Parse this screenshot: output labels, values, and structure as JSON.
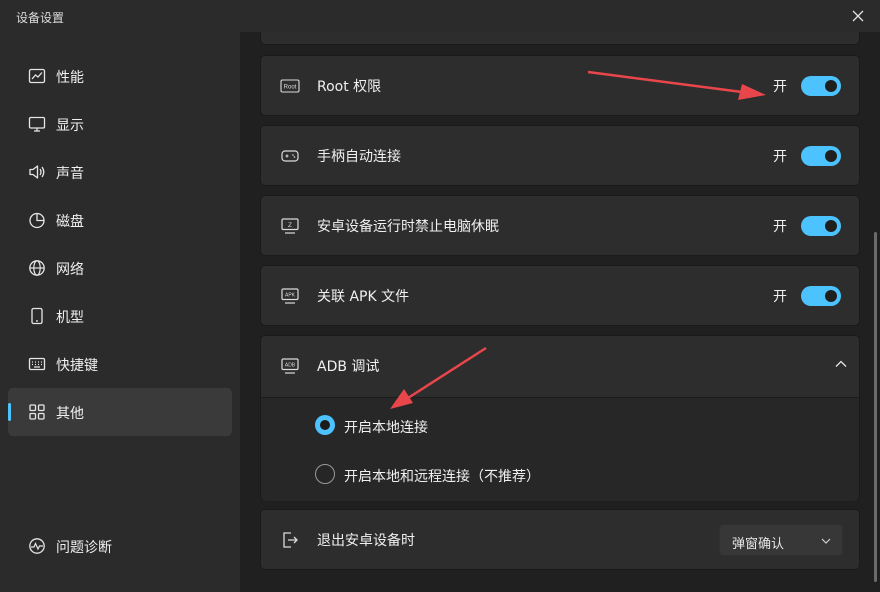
{
  "window": {
    "title": "设备设置"
  },
  "sidebar": {
    "items": [
      {
        "label": "性能",
        "icon": "performance-chart-icon"
      },
      {
        "label": "显示",
        "icon": "monitor-icon"
      },
      {
        "label": "声音",
        "icon": "speaker-icon"
      },
      {
        "label": "磁盘",
        "icon": "disk-pie-icon"
      },
      {
        "label": "网络",
        "icon": "globe-icon"
      },
      {
        "label": "机型",
        "icon": "phone-icon"
      },
      {
        "label": "快捷键",
        "icon": "keyboard-icon"
      },
      {
        "label": "其他",
        "icon": "grid-icon",
        "active": true
      }
    ],
    "diagnose_label": "问题诊断"
  },
  "settings": {
    "root": {
      "label": "Root 权限",
      "state_text": "开",
      "on": true,
      "icon": "root-icon",
      "icon_text": "Root"
    },
    "gamepad": {
      "label": "手柄自动连接",
      "state_text": "开",
      "on": true,
      "icon": "gamepad-icon"
    },
    "nosleep": {
      "label": "安卓设备运行时禁止电脑休眠",
      "state_text": "开",
      "on": true,
      "icon": "sleep-icon",
      "icon_text": "Z"
    },
    "apk": {
      "label": "关联 APK 文件",
      "state_text": "开",
      "on": true,
      "icon": "apk-icon",
      "icon_text": "APK"
    },
    "adb": {
      "label": "ADB 调试",
      "icon": "adb-icon",
      "icon_text": "ADB",
      "expanded": true,
      "options": [
        {
          "label": "开启本地连接",
          "selected": true
        },
        {
          "label": "开启本地和远程连接（不推荐）",
          "selected": false
        }
      ]
    },
    "exit": {
      "label": "退出安卓设备时",
      "icon": "exit-icon",
      "select_value": "弹窗确认"
    }
  },
  "colors": {
    "accent": "#4cc2ff",
    "arrow": "#e8464b"
  }
}
